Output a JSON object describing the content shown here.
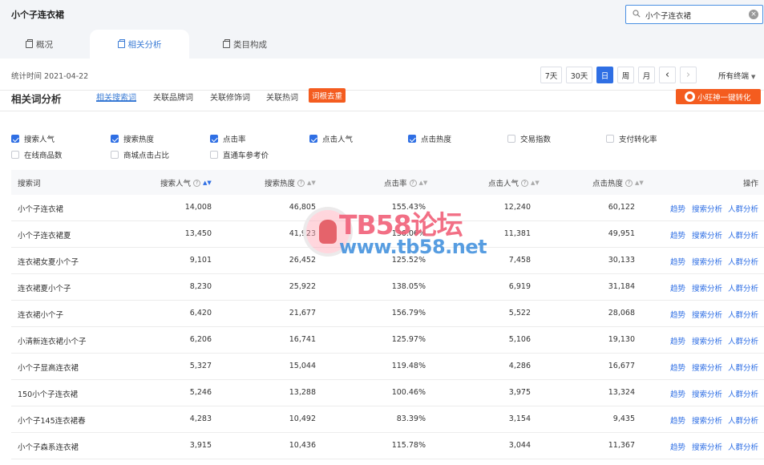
{
  "header": {
    "title": "小个子连衣裙",
    "search_value": "小个子连衣裙",
    "clear_icon": "×"
  },
  "tabs": [
    {
      "label": "概况"
    },
    {
      "label": "相关分析"
    },
    {
      "label": "类目构成"
    }
  ],
  "active_tab": "相关分析",
  "date_bar": {
    "stat_time": "统计时间 2021-04-22",
    "buttons": [
      "7天",
      "30天",
      "日",
      "周",
      "月"
    ],
    "active": "日",
    "prev": "‹",
    "next": "›",
    "terminal": "所有终端"
  },
  "analysis": {
    "title": "相关词分析",
    "subtabs": [
      "相关搜索词",
      "关联品牌词",
      "关联修饰词",
      "关联热词"
    ],
    "active_subtab": "相关搜索词",
    "dedupe_label": "词根去重",
    "convert_label": "小旺神一键转化"
  },
  "checkboxes": [
    {
      "label": "搜索人气",
      "checked": true
    },
    {
      "label": "搜索热度",
      "checked": true
    },
    {
      "label": "点击率",
      "checked": true
    },
    {
      "label": "点击人气",
      "checked": true
    },
    {
      "label": "点击热度",
      "checked": true
    },
    {
      "label": "交易指数",
      "checked": false
    },
    {
      "label": "支付转化率",
      "checked": false
    },
    {
      "label": "在线商品数",
      "checked": false
    },
    {
      "label": "商城点击占比",
      "checked": false
    },
    {
      "label": "直通车参考价",
      "checked": false
    }
  ],
  "table": {
    "columns": [
      "搜索词",
      "搜索人气",
      "搜索热度",
      "点击率",
      "点击人气",
      "点击热度",
      "操作"
    ],
    "help_glyph": "?",
    "sort_glyph": "▲▼",
    "actions": [
      "趋势",
      "搜索分析",
      "人群分析"
    ],
    "rows": [
      [
        "小个子连衣裙",
        "14,008",
        "46,805",
        "155.43%",
        "12,240",
        "60,122"
      ],
      [
        "小个子连衣裙夏",
        "13,450",
        "41,923",
        "136.06%",
        "11,381",
        "49,951"
      ],
      [
        "连衣裙女夏小个子",
        "9,101",
        "26,452",
        "125.52%",
        "7,458",
        "30,133"
      ],
      [
        "连衣裙夏小个子",
        "8,230",
        "25,922",
        "138.05%",
        "6,919",
        "31,184"
      ],
      [
        "连衣裙小个子",
        "6,420",
        "21,677",
        "156.79%",
        "5,522",
        "28,068"
      ],
      [
        "小清新连衣裙小个子",
        "6,206",
        "16,741",
        "125.97%",
        "5,106",
        "19,130"
      ],
      [
        "小个子显高连衣裙",
        "5,327",
        "15,044",
        "119.48%",
        "4,286",
        "16,677"
      ],
      [
        "150小个子连衣裙",
        "5,246",
        "13,288",
        "100.46%",
        "3,975",
        "13,324"
      ],
      [
        "小个子145连衣裙春",
        "4,283",
        "10,492",
        "83.39%",
        "3,154",
        "9,435"
      ],
      [
        "小个子森系连衣裙",
        "3,915",
        "10,436",
        "115.78%",
        "3,044",
        "11,367"
      ]
    ]
  },
  "watermark": {
    "line1": "TB58论坛",
    "line2": "www.tb58.net"
  },
  "colors": {
    "accent": "#2f6fe4",
    "orange": "#f45c1f",
    "header_bg": "#f3f5f8"
  }
}
